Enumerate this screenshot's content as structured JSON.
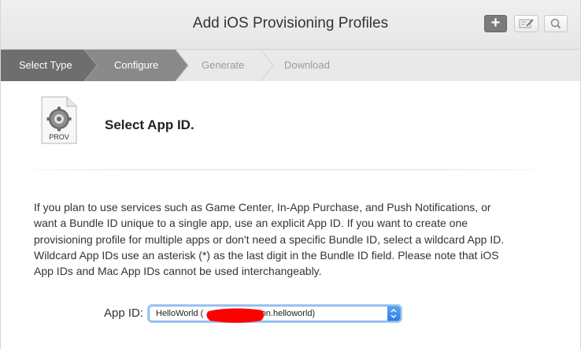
{
  "header": {
    "title": "Add iOS Provisioning Profiles",
    "buttons": [
      {
        "icon": "plus-icon"
      },
      {
        "icon": "edit-icon"
      },
      {
        "icon": "search-icon"
      }
    ]
  },
  "steps": [
    {
      "label": "Select Type",
      "state": "done"
    },
    {
      "label": "Configure",
      "state": "active"
    },
    {
      "label": "Generate",
      "state": "upcoming"
    },
    {
      "label": "Download",
      "state": "upcoming"
    }
  ],
  "main": {
    "icon_label": "PROV",
    "section_title": "Select App ID.",
    "description": "If you plan to use services such as Game Center, In-App Purchase, and Push Notifications, or want a Bundle ID unique to a single app, use an explicit App ID. If you want to create one provisioning profile for multiple apps or don't need a specific Bundle ID, select a wildcard App ID. Wildcard App IDs use an asterisk (*) as the last digit in the Bundle ID field. Please note that iOS App IDs and Mac App IDs cannot be used interchangeably.",
    "app_id_label": "App ID:",
    "app_id_selected": "HelloWorld (                     .com.neutrofoton.helloworld)"
  },
  "colors": {
    "active_step": "#8a8a8a",
    "done_step": "#6e6e6e",
    "select_focus": "#6ea8e8",
    "redaction": "#ff0000"
  }
}
